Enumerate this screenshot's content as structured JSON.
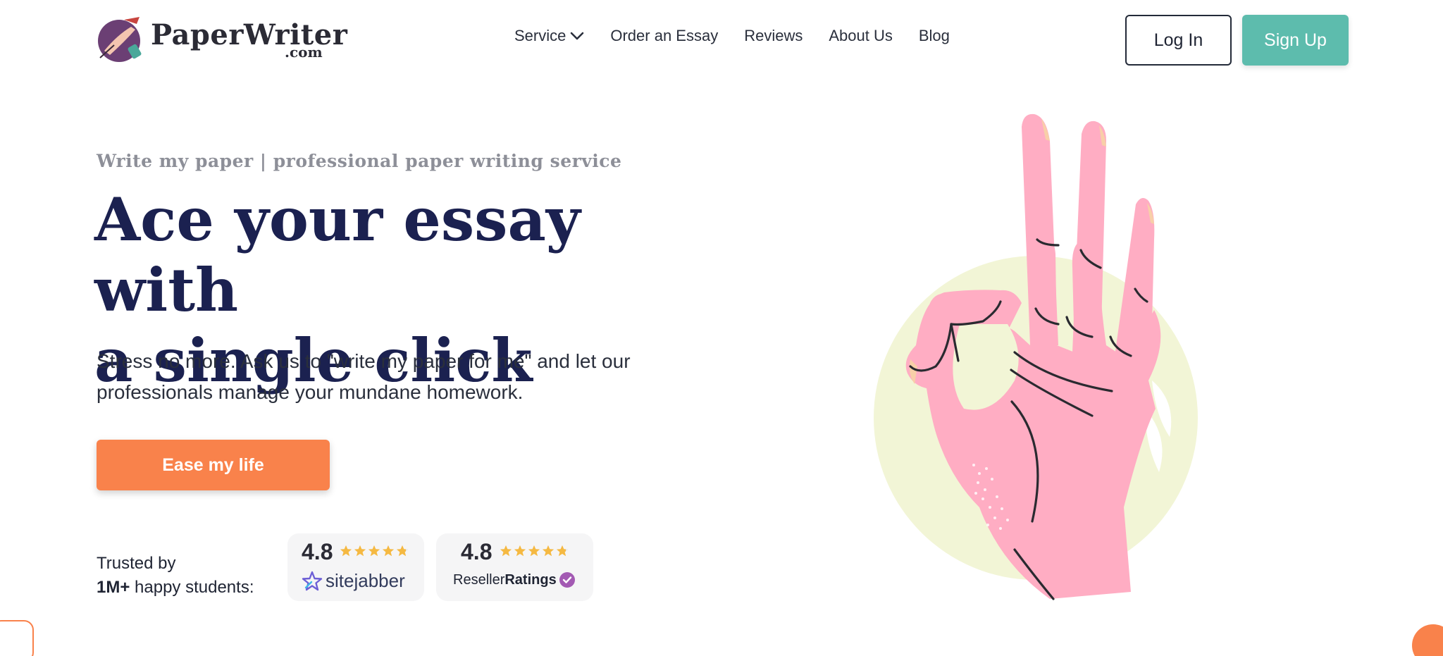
{
  "brand": {
    "name": "PaperWriter",
    "suffix": ".com"
  },
  "nav": {
    "items": [
      {
        "label": "Service"
      },
      {
        "label": "Order an Essay"
      },
      {
        "label": "Reviews"
      },
      {
        "label": "About Us"
      },
      {
        "label": "Blog"
      }
    ]
  },
  "auth": {
    "login_label": "Log In",
    "signup_label": "Sign Up"
  },
  "hero": {
    "kicker": "Write my paper | professional paper writing service",
    "headline_line1": "Ace your essay with",
    "headline_line2": "a single click",
    "subtext": "Stress no more. Ask us to \"write my paper for me\" and let our professionals manage your mundane homework.",
    "cta_label": "Ease my life"
  },
  "trust": {
    "line1": "Trusted by",
    "line2_bold": "1M+",
    "line2_rest": " happy students:",
    "ratings": [
      {
        "score": "4.8",
        "stars": 4.8,
        "brand": "sitejabber"
      },
      {
        "score": "4.8",
        "stars": 4.8,
        "brand_regular": "Reseller",
        "brand_bold": "Ratings"
      }
    ]
  },
  "colors": {
    "accent_orange": "#f9824b",
    "accent_teal": "#5dbcad",
    "headline_navy": "#1b2150",
    "star_gold": "#f5b942",
    "hand_pink": "#ffadc3",
    "circle_cream": "#f2f5d6"
  },
  "icons": {
    "logo": "quill-logo-icon",
    "service_dropdown": "chevron-down-icon",
    "sitejabber": "sitejabber-star-icon",
    "reseller_verified": "verified-check-icon"
  }
}
